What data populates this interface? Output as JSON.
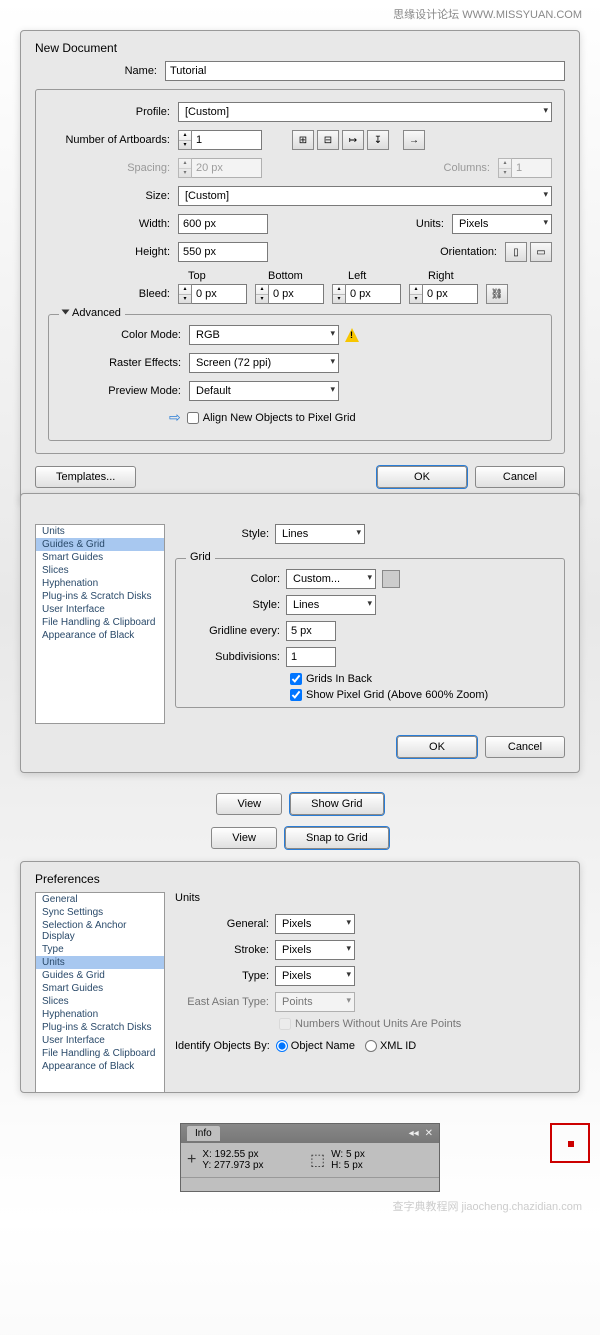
{
  "watermark_top": "思缘设计论坛   WWW.MISSYUAN.COM",
  "watermark_bottom": "查字典教程网 jiaocheng.chazidian.com",
  "newdoc": {
    "title": "New Document",
    "name_label": "Name:",
    "name_value": "Tutorial",
    "profile_label": "Profile:",
    "profile_value": "[Custom]",
    "artboards_label": "Number of Artboards:",
    "artboards_value": "1",
    "spacing_label": "Spacing:",
    "spacing_value": "20 px",
    "columns_label": "Columns:",
    "columns_value": "1",
    "size_label": "Size:",
    "size_value": "[Custom]",
    "width_label": "Width:",
    "width_value": "600 px",
    "height_label": "Height:",
    "height_value": "550 px",
    "units_label": "Units:",
    "units_value": "Pixels",
    "orientation_label": "Orientation:",
    "bleed_label": "Bleed:",
    "bleed_headers": {
      "top": "Top",
      "bottom": "Bottom",
      "left": "Left",
      "right": "Right"
    },
    "bleed_vals": {
      "top": "0 px",
      "bottom": "0 px",
      "left": "0 px",
      "right": "0 px"
    },
    "advanced_label": "Advanced",
    "colormode_label": "Color Mode:",
    "colormode_value": "RGB",
    "raster_label": "Raster Effects:",
    "raster_value": "Screen (72 ppi)",
    "preview_label": "Preview Mode:",
    "preview_value": "Default",
    "align_label": "Align New Objects to Pixel Grid",
    "templates_btn": "Templates...",
    "ok_btn": "OK",
    "cancel_btn": "Cancel"
  },
  "prefs1": {
    "sidebar": [
      "Units",
      "Guides & Grid",
      "Smart Guides",
      "Slices",
      "Hyphenation",
      "Plug-ins & Scratch Disks",
      "User Interface",
      "File Handling & Clipboard",
      "Appearance of Black"
    ],
    "selected_index": 1,
    "style_label": "Style:",
    "style_value": "Lines",
    "grid_legend": "Grid",
    "color_label": "Color:",
    "color_value": "Custom...",
    "grid_style_label": "Style:",
    "grid_style_value": "Lines",
    "gridline_label": "Gridline every:",
    "gridline_value": "5 px",
    "subdiv_label": "Subdivisions:",
    "subdiv_value": "1",
    "grids_back": "Grids In Back",
    "show_pixel": "Show Pixel Grid (Above 600% Zoom)",
    "ok_btn": "OK",
    "cancel_btn": "Cancel"
  },
  "btnpairs": {
    "view1": "View",
    "showgrid": "Show Grid",
    "view2": "View",
    "snap": "Snap to Grid"
  },
  "prefs2": {
    "title": "Preferences",
    "sidebar": [
      "General",
      "Sync Settings",
      "Selection & Anchor Display",
      "Type",
      "Units",
      "Guides & Grid",
      "Smart Guides",
      "Slices",
      "Hyphenation",
      "Plug-ins & Scratch Disks",
      "User Interface",
      "File Handling & Clipboard",
      "Appearance of Black"
    ],
    "selected_index": 4,
    "section": "Units",
    "general_label": "General:",
    "general_value": "Pixels",
    "stroke_label": "Stroke:",
    "stroke_value": "Pixels",
    "type_label": "Type:",
    "type_value": "Pixels",
    "east_label": "East Asian Type:",
    "east_value": "Points",
    "numbers_label": "Numbers Without Units Are Points",
    "identify_label": "Identify Objects By:",
    "obj_name": "Object Name",
    "xml_id": "XML ID"
  },
  "info": {
    "tab": "Info",
    "x_label": "X:",
    "x_value": "192.55 px",
    "y_label": "Y:",
    "y_value": "277.973 px",
    "w_label": "W:",
    "w_value": "5 px",
    "h_label": "H:",
    "h_value": "5 px"
  }
}
